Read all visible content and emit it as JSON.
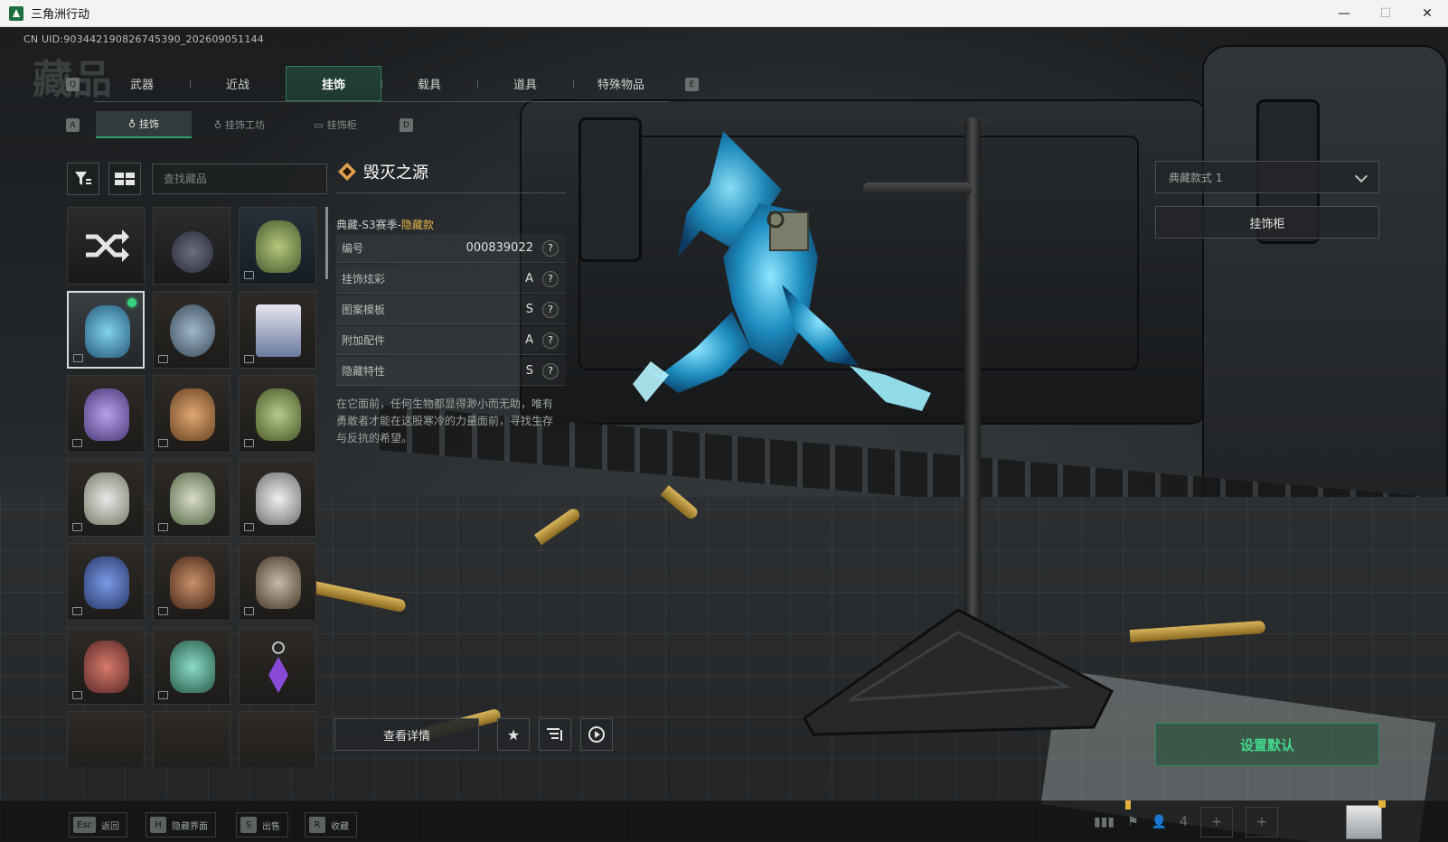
{
  "window": {
    "title": "三角洲行动",
    "minimize": "—",
    "maximize": "☐",
    "close": "✕"
  },
  "uid": "CN UID:9034421908267453​90_202609051144",
  "watermark": "藏品",
  "tabs": {
    "left_key": "Q",
    "right_key": "E",
    "items": [
      "武器",
      "近战",
      "挂饰",
      "载具",
      "道具",
      "特殊物品"
    ],
    "active_index": 2
  },
  "subtabs": {
    "left_key": "A",
    "right_key": "D",
    "items": [
      "挂饰",
      "挂饰工坊",
      "挂饰柜"
    ],
    "active_index": 0
  },
  "toolbar": {
    "filter_icon": "filter-icon",
    "layout_icon": "grid-layout-icon",
    "search_placeholder": "查找藏品"
  },
  "detail": {
    "name": "毁灭之源",
    "season_prefix": "典藏-S3赛季-",
    "season_tag": "隐藏款",
    "attributes": [
      {
        "label": "编号",
        "value": "000839022"
      },
      {
        "label": "挂饰炫彩",
        "value": "A"
      },
      {
        "label": "图案模板",
        "value": "S"
      },
      {
        "label": "附加配件",
        "value": "A"
      },
      {
        "label": "隐藏特性",
        "value": "S"
      }
    ],
    "help": "?",
    "description": "在它面前，任何生物都显得渺小而无助，唯有勇敢者才能在这股寒冷的力量面前，寻找生存与反抗的希望。",
    "view_details": "查看详情",
    "favorite_icon": "star-icon",
    "compare_icon": "list-filter-icon",
    "play_icon": "play-circle-icon"
  },
  "right_panel": {
    "style_select": "典藏款式 1",
    "cabinet_button": "挂饰柜",
    "set_default_button": "设置默认"
  },
  "bottom_hints": [
    {
      "key": "Esc",
      "label": "返回"
    },
    {
      "key": "H",
      "label": "隐藏界面"
    },
    {
      "key": "S",
      "label": "出售"
    },
    {
      "key": "R",
      "label": "收藏"
    }
  ],
  "status_bar": {
    "team_count": "4"
  },
  "colors": {
    "accent_green": "#33a06b",
    "hidden_tag": "#e7b64a",
    "selected_dot": "#36d17b"
  }
}
